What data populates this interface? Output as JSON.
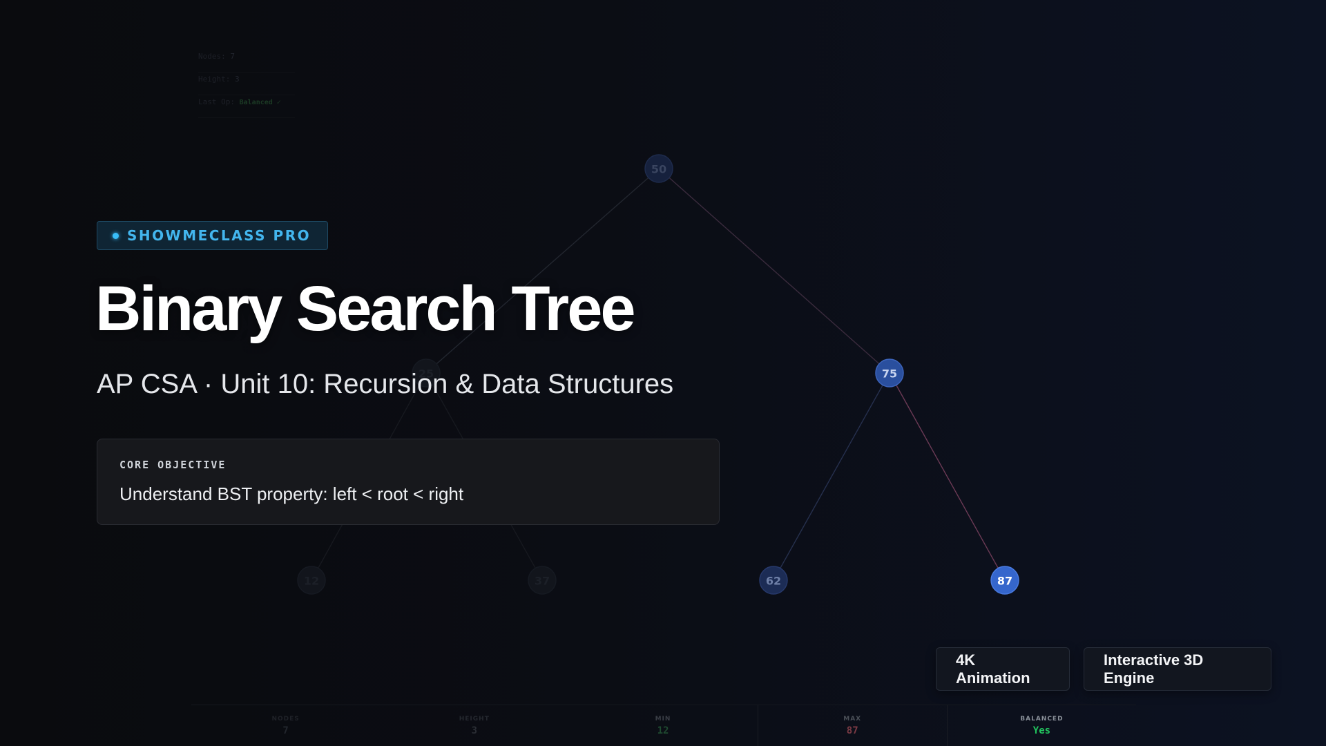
{
  "brand": {
    "label": "SHOWMECLASS PRO"
  },
  "title": "Binary Search Tree",
  "subtitle": "AP CSA · Unit 10: Recursion & Data Structures",
  "objective": {
    "label": "CORE OBJECTIVE",
    "text": "Understand BST property: left < root < right"
  },
  "features": [
    "4K Animation",
    "Interactive 3D Engine"
  ],
  "mini_stats": [
    {
      "label": "Nodes:",
      "value": "7"
    },
    {
      "label": "Height:",
      "value": "3"
    },
    {
      "label": "Last Op:",
      "value": "Balanced ✓"
    }
  ],
  "tree": {
    "nodes": [
      {
        "id": "n50",
        "value": "50",
        "state": "dim"
      },
      {
        "id": "n25",
        "value": "25",
        "state": "hidden"
      },
      {
        "id": "n75",
        "value": "75",
        "state": "active"
      },
      {
        "id": "n12",
        "value": "12",
        "state": "hidden"
      },
      {
        "id": "n37",
        "value": "37",
        "state": "hidden"
      },
      {
        "id": "n62",
        "value": "62",
        "state": "mid"
      },
      {
        "id": "n87",
        "value": "87",
        "state": "bright"
      }
    ],
    "edges": [
      {
        "from": "n50",
        "to": "n25",
        "color": "#22262f"
      },
      {
        "from": "n50",
        "to": "n75",
        "color": "#3a2b3d"
      },
      {
        "from": "n25",
        "to": "n12",
        "color": "#17191f"
      },
      {
        "from": "n25",
        "to": "n37",
        "color": "#17191f"
      },
      {
        "from": "n75",
        "to": "n62",
        "color": "#26304e"
      },
      {
        "from": "n75",
        "to": "n87",
        "color": "#6b3a55"
      }
    ]
  },
  "stats": [
    {
      "label": "NODES",
      "value": "7",
      "label_color": "#1f2228",
      "value_color": "#22262d"
    },
    {
      "label": "HEIGHT",
      "value": "3",
      "label_color": "#25282f",
      "value_color": "#2a2d34"
    },
    {
      "label": "MIN",
      "value": "12",
      "label_color": "#3a3e46",
      "value_color": "#1f4a30"
    },
    {
      "label": "MAX",
      "value": "87",
      "label_color": "#4b5058",
      "value_color": "#7a3a44"
    },
    {
      "label": "BALANCED",
      "value": "Yes",
      "label_color": "#8a9099",
      "value_color": "#22c55e"
    }
  ],
  "colors": {
    "accent": "#38bdf8",
    "node_active": "#2f5bb5",
    "node_bright": "#3b6fd4",
    "balanced_green": "#22c55e"
  }
}
